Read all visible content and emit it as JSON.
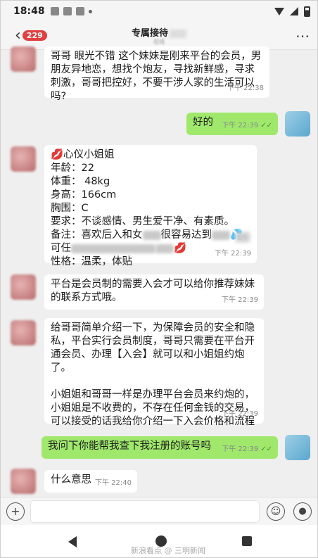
{
  "status_bar": {
    "time": "18:48"
  },
  "header": {
    "back_badge": "229",
    "title": "专属接待",
    "subtitle": "在线"
  },
  "messages": [
    {
      "from": "other",
      "text": "哥哥 眼光不错 这个妹妹是刚来平台的会员，男\n朋友异地恋，想找个炮友，寻找新鲜感，寻求\n刺激，哥哥把控好，不要干涉人家的生活可以\n吗?",
      "time": "下午 22:38"
    },
    {
      "from": "me",
      "text": "好的",
      "time": "下午 22:39"
    },
    {
      "from": "other",
      "profile": {
        "name_line": "💋心仪小姐姐",
        "age": "年龄：22",
        "weight": "体重： 48kg",
        "height": "身高：166cm",
        "chest": "胸围：C",
        "requirement": "要求：不谈感情、男生爱干净、有素质。",
        "note_a": "备注：喜欢后入和女",
        "note_b": "很容易达到",
        "note_c": "💦",
        "note_d": "可任",
        "note_e": "💋",
        "personality": "性格：温柔，体贴"
      },
      "time": "下午 22:39"
    },
    {
      "from": "other",
      "text": "平台是会员制的需要入会才可以给你推荐妹妹\n的联系方式哦。",
      "time": "下午 22:39"
    },
    {
      "from": "other",
      "text": "给哥哥简单介绍一下，为保障会员的安全和隐\n私，平台实行会员制度，哥哥只需要在平台开\n通会员、办理【入会】就可以和小姐姐约炮了。\n\n小姐姐和哥哥一样是办理平台会员来约炮的，\n小姐姐是不收费的，不存在任何金钱的交易，\n可以接受的话我给你介绍一下入会价格和流程",
      "time": "下午 22:39"
    },
    {
      "from": "me",
      "text": "我问下你能帮我查下我注册的账号吗",
      "time": "下午 22:39"
    },
    {
      "from": "other",
      "text": "什么意思",
      "time": "下午 22:40"
    }
  ],
  "input_bar": {
    "placeholder": ""
  },
  "watermark": "新浪看点 @ 三明新闻"
}
